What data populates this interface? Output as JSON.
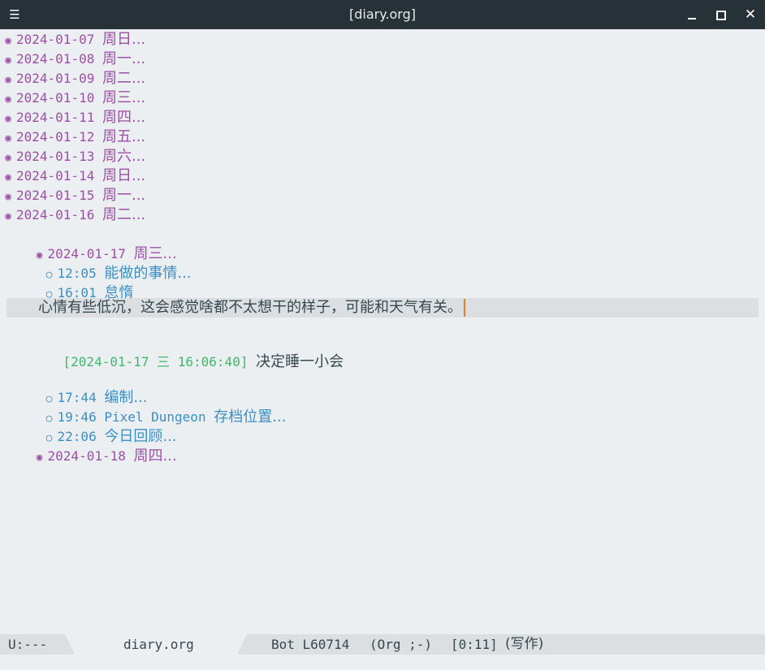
{
  "window": {
    "title": "[diary.org]",
    "menu_icon": "hamburger-icon",
    "minimize_icon": "minimize-icon",
    "maximize_icon": "maximize-icon",
    "close_glyph": "✕"
  },
  "colors": {
    "titlebar_bg": "#263238",
    "buffer_bg": "#eceff1",
    "heading1": "#9c4fa6",
    "heading2": "#3a8fc4",
    "timestamp": "#3fb86b",
    "text": "#37474f",
    "cursor": "#e67e22",
    "hl_line": "#dcdfe1"
  },
  "bullets": {
    "level1": "◉",
    "level2": "○"
  },
  "outline": {
    "days_before": [
      {
        "date": "2024-01-07",
        "dow": "周日..."
      },
      {
        "date": "2024-01-08",
        "dow": "周一..."
      },
      {
        "date": "2024-01-09",
        "dow": "周二..."
      },
      {
        "date": "2024-01-10",
        "dow": "周三..."
      },
      {
        "date": "2024-01-11",
        "dow": "周四..."
      },
      {
        "date": "2024-01-12",
        "dow": "周五..."
      },
      {
        "date": "2024-01-13",
        "dow": "周六..."
      },
      {
        "date": "2024-01-14",
        "dow": "周日..."
      },
      {
        "date": "2024-01-15",
        "dow": "周一..."
      },
      {
        "date": "2024-01-16",
        "dow": "周二..."
      }
    ],
    "current_day": {
      "date": "2024-01-17",
      "dow": "周三..."
    },
    "entries_before": [
      {
        "time": "12:05",
        "title": "能做的事情..."
      },
      {
        "time": "16:01",
        "title": "怠惰"
      }
    ],
    "body_text": "心情有些低沉，这会感觉啥都不太想干的样子，可能和天气有关。",
    "log_timestamp": "[2024-01-17 三 16:06:40]",
    "log_text": "决定睡一小会",
    "entries_after": [
      {
        "time": "17:44",
        "title": "编制...",
        "mono": ""
      },
      {
        "time": "19:46",
        "title": "存档位置...",
        "mono": "Pixel Dungeon "
      },
      {
        "time": "22:06",
        "title": "今日回顾...",
        "mono": ""
      }
    ],
    "next_day": {
      "date": "2024-01-18",
      "dow": "周四..."
    }
  },
  "modeline": {
    "state": "U:---",
    "buffer": "diary.org",
    "position": "Bot L60714",
    "mode": "(Org ;-)",
    "time": "[0:11]",
    "extra": "(写作)"
  }
}
